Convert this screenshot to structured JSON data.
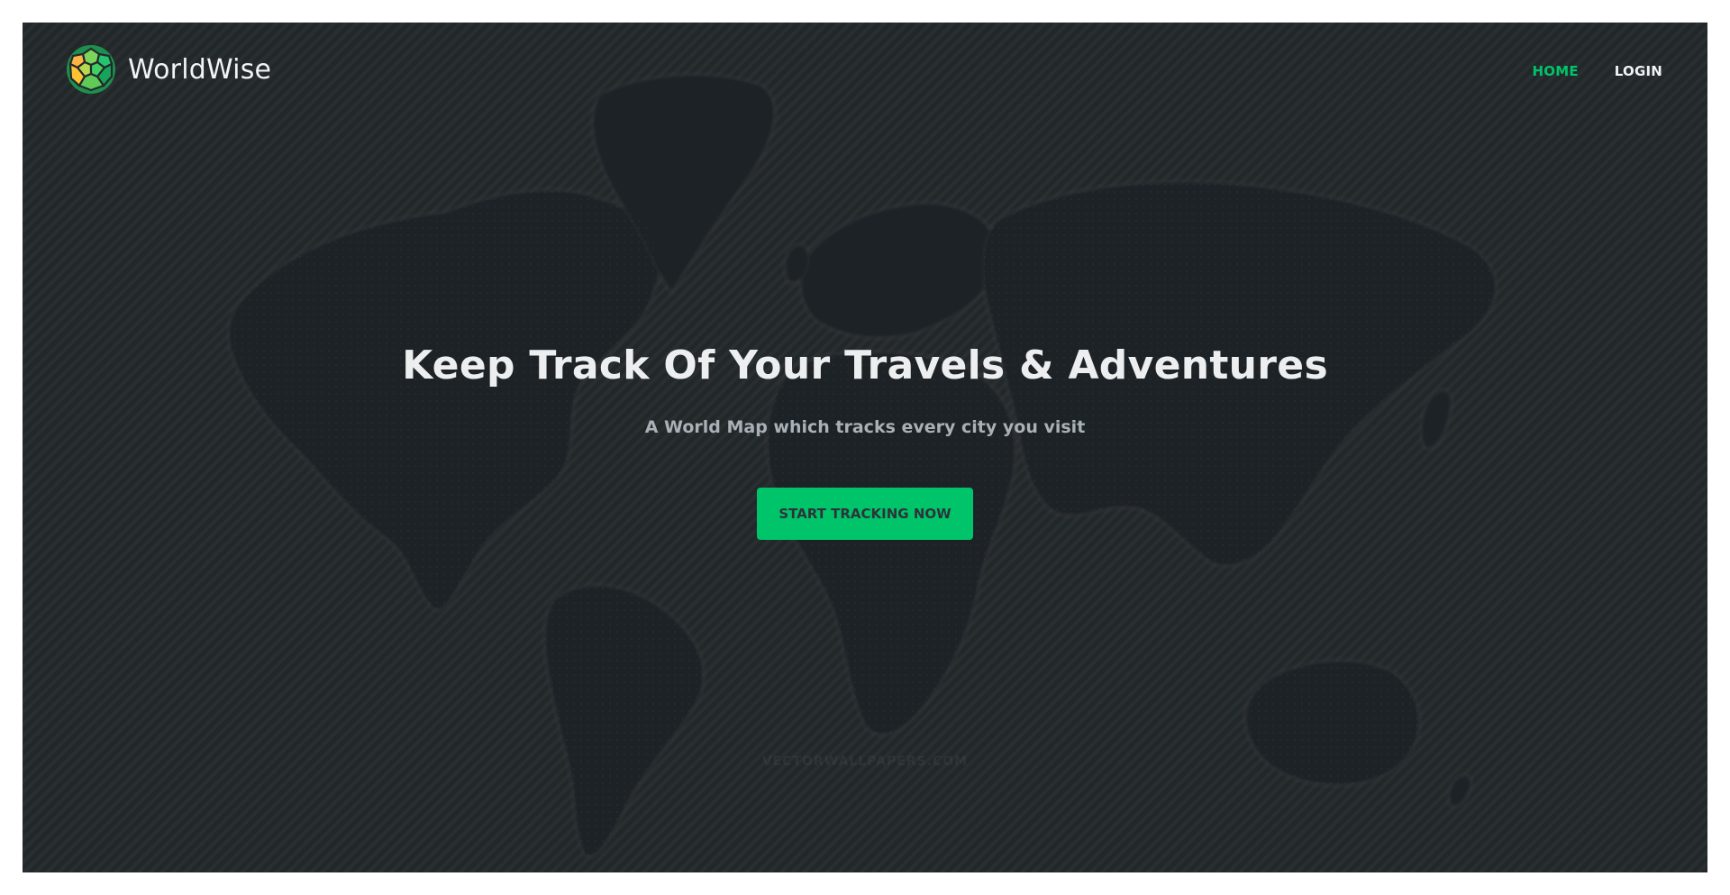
{
  "app": {
    "brand": "WorldWise",
    "accent_color": "#00c46a",
    "background_color": "#24292c"
  },
  "nav": {
    "logo_icon": "globe-mosaic-icon",
    "items": [
      {
        "label": "HOME",
        "active": true
      },
      {
        "label": "LOGIN",
        "active": false
      }
    ]
  },
  "hero": {
    "title": "Keep Track Of Your Travels & Adventures",
    "subtitle": "A World Map which tracks every city you visit",
    "cta_label": "START TRACKING NOW",
    "background": "world-map-illustration",
    "watermark": "VECTORWALLPAPERS.COM"
  }
}
